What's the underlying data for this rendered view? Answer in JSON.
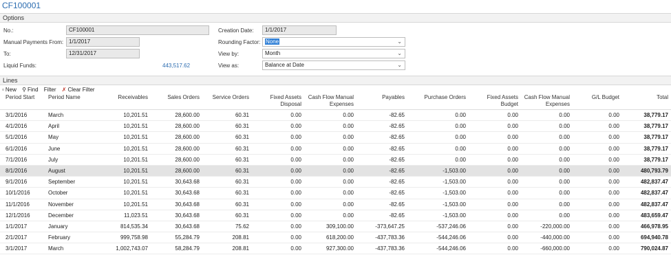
{
  "page": {
    "title": "CF100001"
  },
  "options": {
    "header": "Options",
    "no_label": "No.:",
    "no_value": "CF100001",
    "payments_from_label": "Manual Payments From:",
    "payments_from_value": "1/1/2017",
    "to_label": "To:",
    "to_value": "12/31/2017",
    "liquid_funds_label": "Liquid Funds:",
    "liquid_funds_value": "443,517.62",
    "creation_date_label": "Creation Date:",
    "creation_date_value": "1/1/2017",
    "rounding_label": "Rounding Factor:",
    "rounding_value": "None",
    "view_by_label": "View by:",
    "view_by_value": "Month",
    "view_as_label": "View as:",
    "view_as_value": "Balance at Date"
  },
  "lines": {
    "header": "Lines",
    "toolbar": {
      "new": "New",
      "find": "Find",
      "filter": "Filter",
      "clear_filter": "Clear Filter"
    },
    "columns": [
      "Period Start",
      "Period Name",
      "Receivables",
      "Sales Orders",
      "Service Orders",
      "Fixed Assets Disposal",
      "Cash Flow Manual Expenses",
      "Payables",
      "Purchase Orders",
      "Fixed Assets Budget",
      "Cash Flow Manual Expenses",
      "G/L Budget",
      "Total"
    ],
    "rows": [
      [
        "3/1/2016",
        "March",
        "10,201.51",
        "28,600.00",
        "60.31",
        "0.00",
        "0.00",
        "-82.65",
        "0.00",
        "0.00",
        "0.00",
        "0.00",
        "38,779.17"
      ],
      [
        "4/1/2016",
        "April",
        "10,201.51",
        "28,600.00",
        "60.31",
        "0.00",
        "0.00",
        "-82.65",
        "0.00",
        "0.00",
        "0.00",
        "0.00",
        "38,779.17"
      ],
      [
        "5/1/2016",
        "May",
        "10,201.51",
        "28,600.00",
        "60.31",
        "0.00",
        "0.00",
        "-82.65",
        "0.00",
        "0.00",
        "0.00",
        "0.00",
        "38,779.17"
      ],
      [
        "6/1/2016",
        "June",
        "10,201.51",
        "28,600.00",
        "60.31",
        "0.00",
        "0.00",
        "-82.65",
        "0.00",
        "0.00",
        "0.00",
        "0.00",
        "38,779.17"
      ],
      [
        "7/1/2016",
        "July",
        "10,201.51",
        "28,600.00",
        "60.31",
        "0.00",
        "0.00",
        "-82.65",
        "0.00",
        "0.00",
        "0.00",
        "0.00",
        "38,779.17"
      ],
      [
        "8/1/2016",
        "August",
        "10,201.51",
        "28,600.00",
        "60.31",
        "0.00",
        "0.00",
        "-82.65",
        "-1,503.00",
        "0.00",
        "0.00",
        "0.00",
        "480,793.79"
      ],
      [
        "9/1/2016",
        "September",
        "10,201.51",
        "30,643.68",
        "60.31",
        "0.00",
        "0.00",
        "-82.65",
        "-1,503.00",
        "0.00",
        "0.00",
        "0.00",
        "482,837.47"
      ],
      [
        "10/1/2016",
        "October",
        "10,201.51",
        "30,643.68",
        "60.31",
        "0.00",
        "0.00",
        "-82.65",
        "-1,503.00",
        "0.00",
        "0.00",
        "0.00",
        "482,837.47"
      ],
      [
        "11/1/2016",
        "November",
        "10,201.51",
        "30,643.68",
        "60.31",
        "0.00",
        "0.00",
        "-82.65",
        "-1,503.00",
        "0.00",
        "0.00",
        "0.00",
        "482,837.47"
      ],
      [
        "12/1/2016",
        "December",
        "11,023.51",
        "30,643.68",
        "60.31",
        "0.00",
        "0.00",
        "-82.65",
        "-1,503.00",
        "0.00",
        "0.00",
        "0.00",
        "483,659.47"
      ],
      [
        "1/1/2017",
        "January",
        "814,535.34",
        "30,643.68",
        "75.62",
        "0.00",
        "309,100.00",
        "-373,647.25",
        "-537,246.06",
        "0.00",
        "-220,000.00",
        "0.00",
        "466,978.95"
      ],
      [
        "2/1/2017",
        "February",
        "999,758.98",
        "55,284.79",
        "208.81",
        "0.00",
        "618,200.00",
        "-437,783.36",
        "-544,246.06",
        "0.00",
        "-440,000.00",
        "0.00",
        "694,940.78"
      ],
      [
        "3/1/2017",
        "March",
        "1,002,743.07",
        "58,284.79",
        "208.81",
        "0.00",
        "927,300.00",
        "-437,783.36",
        "-544,246.06",
        "0.00",
        "-660,000.00",
        "0.00",
        "790,024.87"
      ]
    ],
    "highlighted_row": 5
  }
}
